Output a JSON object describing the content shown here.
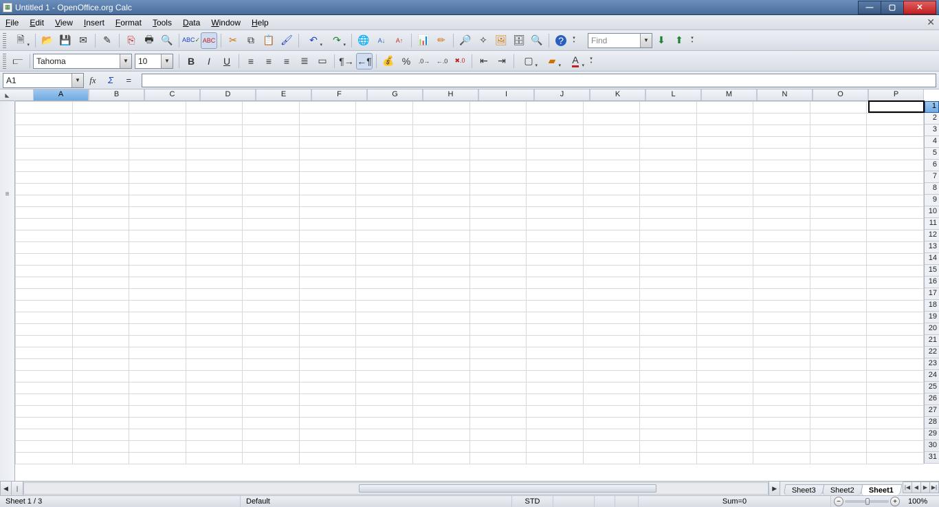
{
  "titlebar": {
    "title": "Untitled 1 - OpenOffice.org Calc"
  },
  "menubar": {
    "items": [
      {
        "key": "F",
        "rest": "ile"
      },
      {
        "key": "E",
        "rest": "dit"
      },
      {
        "key": "V",
        "rest": "iew"
      },
      {
        "key": "I",
        "rest": "nsert"
      },
      {
        "key": "F",
        "rest": "ormat",
        "pre": "F",
        "label": "Format"
      },
      {
        "key": "T",
        "rest": "ools"
      },
      {
        "key": "D",
        "rest": "ata"
      },
      {
        "key": "W",
        "rest": "indow"
      },
      {
        "key": "H",
        "rest": "elp"
      }
    ],
    "labels": [
      "File",
      "Edit",
      "View",
      "Insert",
      "Format",
      "Tools",
      "Data",
      "Window",
      "Help"
    ]
  },
  "toolbar1_icons": [
    "new",
    "open",
    "save",
    "mail",
    "edit-doc",
    "pdf",
    "print",
    "preview",
    "spellcheck",
    "autospell",
    "cut",
    "copy",
    "paste",
    "format-paint",
    "undo",
    "redo",
    "hyperlink",
    "sort-asc",
    "sort-desc",
    "chart",
    "show-draw",
    "find-replace",
    "navigator",
    "gallery",
    "datasources",
    "zoom",
    "help"
  ],
  "find": {
    "placeholder": "Find"
  },
  "format_toolbar": {
    "font_name": "Tahoma",
    "font_size": "10",
    "bold_label": "B",
    "italic_label": "I",
    "underline_label": "U",
    "currency_icon": "currency",
    "percent_icon": "%"
  },
  "formula_bar": {
    "cell_ref": "A1",
    "fx_label": "fx",
    "sigma_label": "Σ",
    "eq_label": "=",
    "value": ""
  },
  "grid": {
    "columns": [
      "P",
      "O",
      "N",
      "M",
      "L",
      "K",
      "J",
      "I",
      "H",
      "G",
      "F",
      "E",
      "D",
      "C",
      "B",
      "A"
    ],
    "selected_column": "A",
    "rows": [
      1,
      2,
      3,
      4,
      5,
      6,
      7,
      8,
      9,
      10,
      11,
      12,
      13,
      14,
      15,
      16,
      17,
      18,
      19,
      20,
      21,
      22,
      23,
      24,
      25,
      26,
      27,
      28,
      29,
      30,
      31
    ],
    "selected_row": 1
  },
  "sheet_tabs": [
    "Sheet3",
    "Sheet2",
    "Sheet1"
  ],
  "active_sheet": "Sheet1",
  "statusbar": {
    "sheet_pos": "Sheet 1 / 3",
    "style": "Default",
    "mode": "STD",
    "sum": "Sum=0",
    "zoom": "100%"
  }
}
